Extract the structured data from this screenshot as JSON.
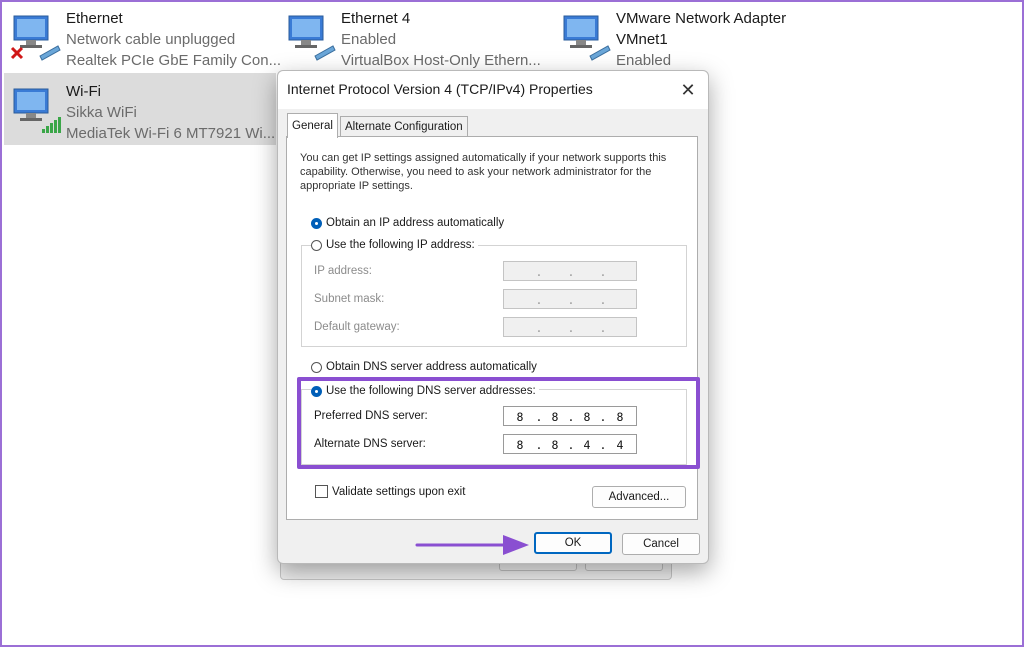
{
  "adapters": [
    {
      "name": "Ethernet",
      "line2": "Network cable unplugged",
      "line3": "Realtek PCIe GbE Family Con...",
      "icon": "network-adapter-disconnected-icon"
    },
    {
      "name": "Ethernet 4",
      "line2": "Enabled",
      "line3": "VirtualBox Host-Only Ethern...",
      "icon": "network-adapter-icon"
    },
    {
      "name": "VMware Network Adapter",
      "line2": "VMnet1",
      "line3": "Enabled",
      "icon": "network-adapter-icon"
    },
    {
      "name": "Wi-Fi",
      "line2": "Sikka WiFi",
      "line3": "MediaTek Wi-Fi 6 MT7921 Wi...",
      "icon": "wifi-adapter-icon"
    }
  ],
  "dialog": {
    "title": "Internet Protocol Version 4 (TCP/IPv4) Properties",
    "close_symbol": "✕",
    "tabs": [
      "General",
      "Alternate Configuration"
    ],
    "active_tab": "General",
    "description": "You can get IP settings assigned automatically if your network supports this capability. Otherwise, you need to ask your network administrator for the appropriate IP settings.",
    "ip_auto_label": "Obtain an IP address automatically",
    "ip_manual_label": "Use the following IP address:",
    "ip_fields": [
      {
        "label": "IP address:",
        "value": ". . ."
      },
      {
        "label": "Subnet mask:",
        "value": ". . ."
      },
      {
        "label": "Default gateway:",
        "value": ". . ."
      }
    ],
    "dns_auto_label": "Obtain DNS server address automatically",
    "dns_manual_label": "Use the following DNS server addresses:",
    "dns_fields": [
      {
        "label": "Preferred DNS server:",
        "octets": [
          "8",
          "8",
          "8",
          "8"
        ]
      },
      {
        "label": "Alternate DNS server:",
        "octets": [
          "8",
          "8",
          "4",
          "4"
        ]
      }
    ],
    "validate_label": "Validate settings upon exit",
    "advanced_label": "Advanced...",
    "ok_label": "OK",
    "cancel_label": "Cancel"
  },
  "colors": {
    "highlight": "#8a4fd1",
    "accent": "#0067c0",
    "selected_row": "#dcdcdc"
  }
}
